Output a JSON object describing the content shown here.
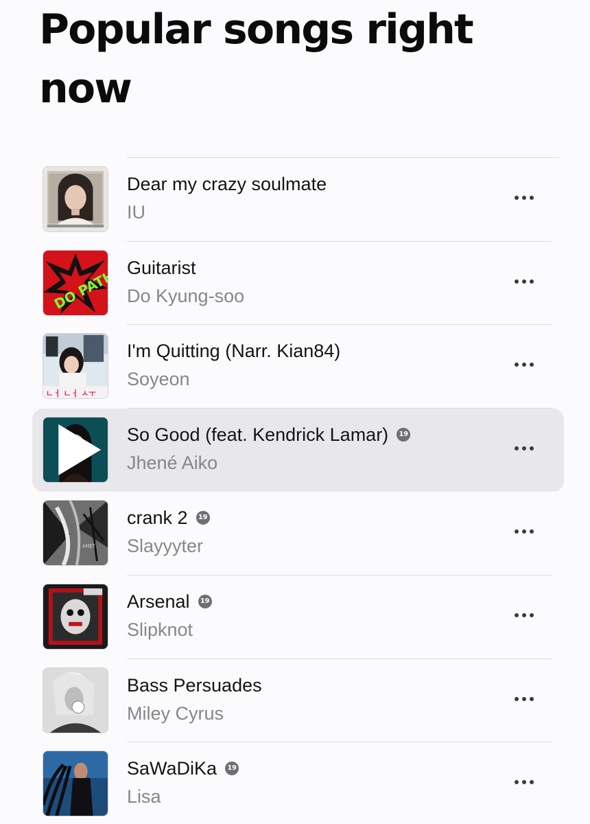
{
  "header": {
    "title": "Popular songs right now"
  },
  "colors": {
    "accent_text": "#141414",
    "secondary_text": "#86868b",
    "highlight_row": "#e8e8ec",
    "badge": "#6e6e73"
  },
  "songs": [
    {
      "title": "Dear my crazy soulmate",
      "artist": "IU",
      "explicit": false,
      "explicit_label": "",
      "highlighted": false,
      "art": "portrait-art-iu"
    },
    {
      "title": "Guitarist",
      "artist": "Do Kyung-soo",
      "explicit": false,
      "explicit_label": "",
      "highlighted": false,
      "art": "graphic-art-red-green"
    },
    {
      "title": "I'm Quitting (Narr. Kian84)",
      "artist": "Soyeon",
      "explicit": false,
      "explicit_label": "",
      "highlighted": false,
      "art": "collage-art"
    },
    {
      "title": "So Good (feat. Kendrick Lamar)",
      "artist": "Jhené Aiko",
      "explicit": true,
      "explicit_label": "19",
      "highlighted": true,
      "art": "portrait-art-teal"
    },
    {
      "title": "crank 2",
      "artist": "Slayyyter",
      "explicit": true,
      "explicit_label": "19",
      "highlighted": false,
      "art": "monochrome-art"
    },
    {
      "title": "Arsenal",
      "artist": "Slipknot",
      "explicit": true,
      "explicit_label": "19",
      "highlighted": false,
      "art": "red-black-art"
    },
    {
      "title": "Bass Persuades",
      "artist": "Miley Cyrus",
      "explicit": false,
      "explicit_label": "",
      "highlighted": false,
      "art": "bw-portrait-art"
    },
    {
      "title": "SaWaDiKa",
      "artist": "Lisa",
      "explicit": true,
      "explicit_label": "19",
      "highlighted": false,
      "art": "blue-portrait-art"
    }
  ],
  "icons": {
    "more": "ellipsis-icon",
    "play": "play-icon",
    "explicit": "explicit-19-badge-icon"
  }
}
